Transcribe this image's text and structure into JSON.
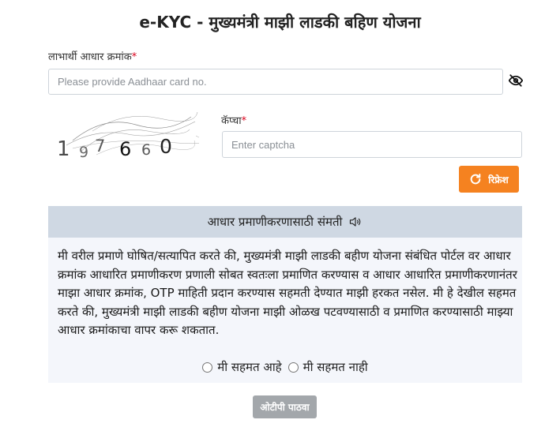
{
  "page": {
    "title": "e-KYC - मुख्यमंत्री माझी लाडकी बहिण योजना"
  },
  "aadhaar": {
    "label": "लाभार्थी आधार क्रमांक",
    "required_mark": "*",
    "placeholder": "Please provide Aadhaar card no.",
    "toggle_icon": "eye-slash-icon"
  },
  "captcha": {
    "digits": [
      "1",
      "9",
      "7",
      "6",
      "6",
      "0"
    ],
    "label": "कॅप्चा",
    "required_mark": "*",
    "placeholder": "Enter captcha",
    "refresh_label": "रिफ्रेश",
    "refresh_icon": "refresh-icon"
  },
  "consent": {
    "header": "आधार प्रमाणीकरणासाठी संमती",
    "audio_icon": "speaker-icon",
    "text": "मी वरील प्रमाणे घोषित/सत्यापित करते की, मुख्यमंत्री माझी लाडकी बहीण योजना संबंधित पोर्टल वर आधार क्रमांक आधारित प्रमाणीकरण प्रणाली सोबत स्वतःला प्रमाणित करण्यास व आधार आधारित प्रमाणीकरणानंतर माझा आधार क्रमांक, OTP माहिती प्रदान करण्यास सहमती देण्यात माझी हरकत नसेल. मी हे देखील सहमत करते की, मुख्यमंत्री माझी लाडकी बहीण योजना माझी ओळख पटवण्यासाठी व प्रमाणित करण्यासाठी माझ्या आधार क्रमांकाचा वापर करू शकतात.",
    "agree_label": "मी सहमत आहे",
    "disagree_label": "मी सहमत नाही"
  },
  "actions": {
    "send_otp_label": "ओटीपी पाठवा"
  },
  "colors": {
    "accent": "#f58220",
    "required": "#d9001b",
    "consent_header_bg": "#cfd8e3",
    "consent_body_bg": "#f4f6fb",
    "disabled_button": "#a3a7ab"
  }
}
